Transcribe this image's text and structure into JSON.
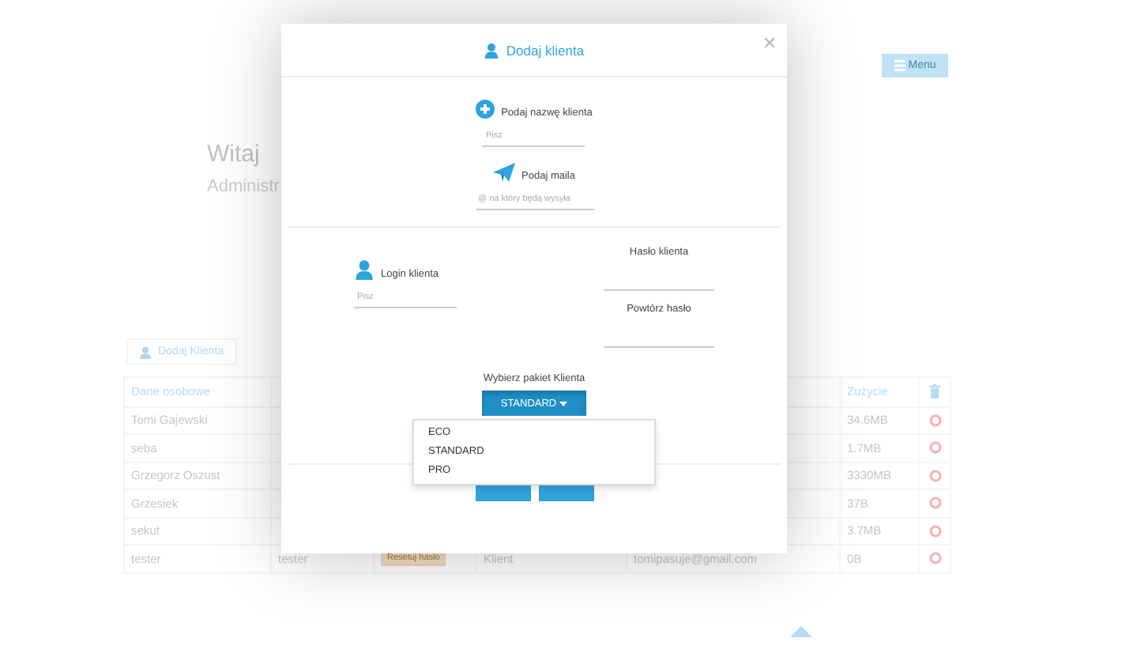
{
  "page": {
    "menu_button": "Menu",
    "greeting": "Witaj",
    "subtitle": "Administr",
    "add_button": "Dodaj Klienta"
  },
  "table": {
    "header": {
      "name": "Dane osobowe",
      "usage": "Zużycie"
    },
    "rows": [
      {
        "name": "Tomi Gajewski",
        "usage": "34.6MB"
      },
      {
        "name": "seba",
        "usage": "1.7MB"
      },
      {
        "name": "Grzegorz Oszust",
        "usage": "3330MB"
      },
      {
        "name": "Grzesiek",
        "usage": "37B"
      },
      {
        "name": "sekut",
        "usage": "3.7MB"
      },
      {
        "name": "tester",
        "login": "tester",
        "action": "Resetuj hasło",
        "role": "Klient",
        "email": "tomipasuje@gmail.com",
        "usage": "0B"
      }
    ]
  },
  "modal": {
    "title": "Dodaj klienta",
    "name_field": {
      "label": "Podaj nazwę klienta",
      "placeholder": "Pisz"
    },
    "email_field": {
      "label": "Podaj maila",
      "placeholder": "@ na który będą wysyła"
    },
    "login_field": {
      "label": "Login klienta",
      "placeholder": "Pisz"
    },
    "password_fields": [
      {
        "label": "Hasło klienta"
      },
      {
        "label": "Powtórz hasło"
      }
    ],
    "package": {
      "label": "Wybierz pakiet Klienta",
      "value": "STANDARD",
      "expanded": true,
      "options": [
        {
          "label": "ECO"
        },
        {
          "label": "STANDARD"
        },
        {
          "label": "PRO"
        }
      ]
    }
  }
}
